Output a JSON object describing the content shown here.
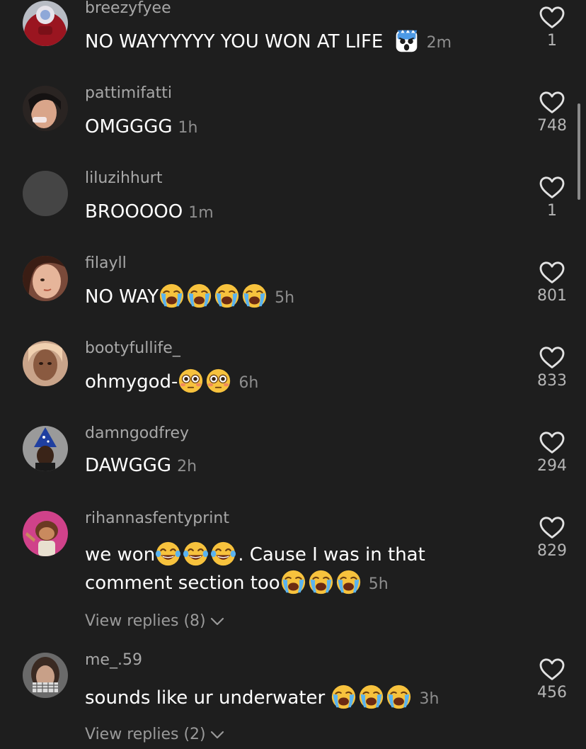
{
  "comments": [
    {
      "username": "breezyfyee",
      "text": "NO WAYYYYYY YOU WON AT LIFE",
      "emoji": [
        "blue-monster-emoji"
      ],
      "time": "2m",
      "likes": "1",
      "avatar": "avatar-red-blue"
    },
    {
      "username": "pattimifatti",
      "text": "OMGGGG",
      "emoji": [],
      "time": "1h",
      "likes": "748",
      "avatar": "avatar-photo-light"
    },
    {
      "username": "liluzihhurt",
      "text": "BROOOOO",
      "emoji": [],
      "time": "1m",
      "likes": "1",
      "avatar": "avatar-placeholder"
    },
    {
      "username": "filayll",
      "text": "NO WAY",
      "emoji": [
        "loudly-crying-face",
        "loudly-crying-face",
        "loudly-crying-face",
        "loudly-crying-face"
      ],
      "time": "5h",
      "likes": "801",
      "avatar": "avatar-photo-warm"
    },
    {
      "username": "bootyfullife_",
      "text": "ohmygod-",
      "emoji": [
        "flushed-face",
        "flushed-face"
      ],
      "time": "6h",
      "likes": "833",
      "avatar": "avatar-photo-tan"
    },
    {
      "username": "damngodfrey",
      "text": "DAWGGG",
      "emoji": [],
      "time": "2h",
      "likes": "294",
      "avatar": "avatar-wizard"
    },
    {
      "username": "rihannasfentyprint",
      "text_line1": "we won",
      "emoji_line1": [
        "face-with-tears-of-joy",
        "face-with-tears-of-joy",
        "face-with-tears-of-joy"
      ],
      "text_line1b": ". Cause I was in that",
      "text_line2": "comment section too",
      "emoji_line2": [
        "loudly-crying-face",
        "loudly-crying-face",
        "loudly-crying-face"
      ],
      "time": "5h",
      "likes": "829",
      "avatar": "avatar-cartoon-pink",
      "replies": "View replies (8)"
    },
    {
      "username": "me_.59",
      "text": "sounds like ur underwater ",
      "emoji": [
        "loudly-crying-face",
        "loudly-crying-face",
        "loudly-crying-face"
      ],
      "time": "3h",
      "likes": "456",
      "avatar": "avatar-photo-grey",
      "replies": "View replies (2)"
    }
  ],
  "colors": {
    "background": "#1e1e1e",
    "username": "#a8a8a8",
    "text": "#ffffff",
    "time": "#8e8e8e",
    "likes": "#b5b5b5"
  },
  "icons": {
    "like": "heart-outline-icon",
    "replies_chevron": "chevron-down-icon"
  }
}
